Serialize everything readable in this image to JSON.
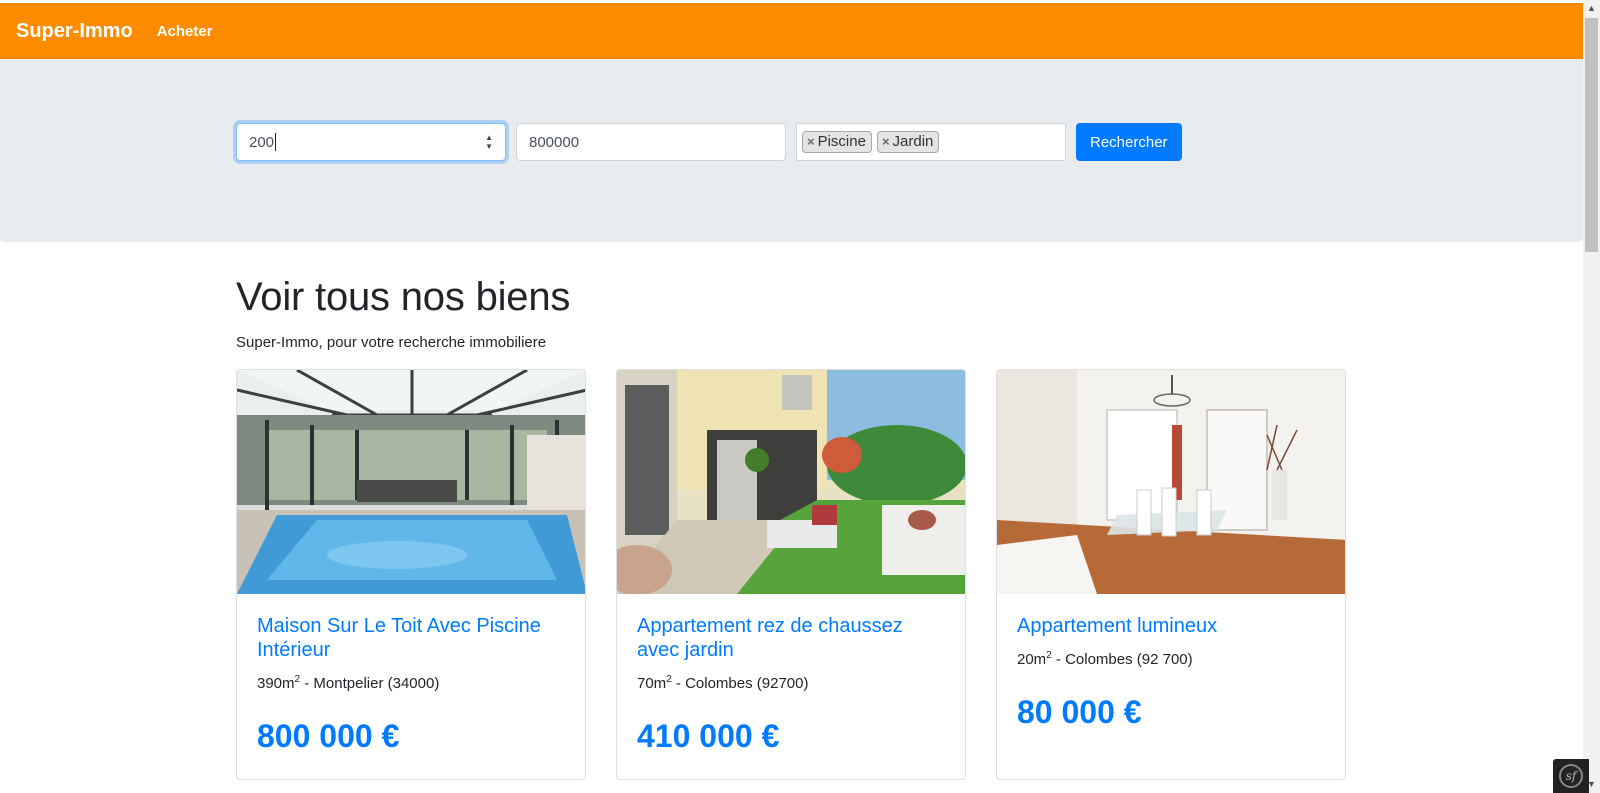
{
  "navbar": {
    "brand": "Super-Immo",
    "links": [
      {
        "label": "Acheter"
      }
    ]
  },
  "search": {
    "surface_value": "200",
    "price_value": "800000",
    "tags": [
      "Piscine",
      "Jardin"
    ],
    "submit_label": "Rechercher"
  },
  "content": {
    "heading": "Voir tous nos biens",
    "lead": "Super-Immo, pour votre recherche immobiliere",
    "cards": [
      {
        "title": "Maison Sur Le Toit Avec Piscine Intérieur",
        "area": "390m",
        "area_exp": "2",
        "location": " - Montpelier (34000)",
        "price": "800 000 €",
        "image": "indoor-pool-photo"
      },
      {
        "title": "Appartement rez de chaussez avec jardin",
        "area": "70m",
        "area_exp": "2",
        "location": " - Colombes (92700)",
        "price": "410 000 €",
        "image": "garden-terrace-photo"
      },
      {
        "title": "Appartement lumineux",
        "area": "20m",
        "area_exp": "2",
        "location": " - Colombes (92 700)",
        "price": "80 000 €",
        "image": "bright-dining-room-photo"
      }
    ]
  },
  "colors": {
    "navbar": "#ff8c00",
    "primary": "#007bff",
    "jumbotron": "#e9ecef"
  }
}
